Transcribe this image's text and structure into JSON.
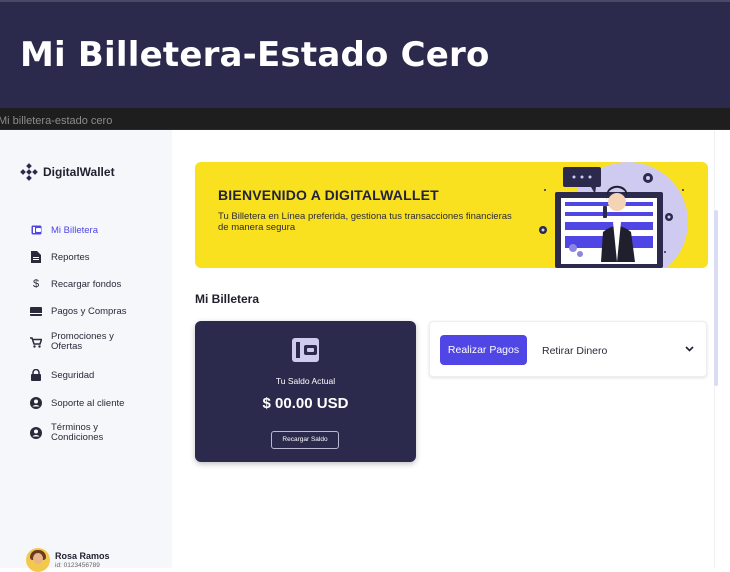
{
  "header": {
    "title": "Mi Billetera-Estado Cero"
  },
  "tab": {
    "label": "Mi billetera-estado cero"
  },
  "sidebar": {
    "brand": "DigitalWallet",
    "items": [
      {
        "label": "Mi Billetera",
        "icon": "wallet-icon",
        "active": true
      },
      {
        "label": "Reportes",
        "icon": "document-icon"
      },
      {
        "label": "Recargar fondos",
        "icon": "dollar-icon"
      },
      {
        "label": "Pagos y Compras",
        "icon": "card-icon"
      },
      {
        "label": "Promociones y\nOfertas",
        "icon": "cart-icon"
      },
      {
        "label": "Seguridad",
        "icon": "lock-icon"
      },
      {
        "label": "Soporte al cliente",
        "icon": "user-circle-icon"
      },
      {
        "label": "Términos y\nCondiciones",
        "icon": "user-circle-icon"
      }
    ],
    "user": {
      "name": "Rosa Ramos",
      "id": "id: 0123456789"
    }
  },
  "banner": {
    "title": "BIENVENIDO A DIGITALWALLET",
    "text": "Tu Billetera en Línea preferida, gestiona tus transacciones financieras de manera segura"
  },
  "main": {
    "section_title": "Mi Billetera",
    "balance": {
      "label": "Tu Saldo Actual",
      "amount": "$ 00.00 USD",
      "button": "Recargar Saldo"
    },
    "actions": {
      "pay": "Realizar Pagos",
      "withdraw": "Retirar Dinero"
    }
  },
  "colors": {
    "primary": "#4f46e5",
    "dark": "#2b2a4c",
    "banner": "#f9e11f"
  }
}
